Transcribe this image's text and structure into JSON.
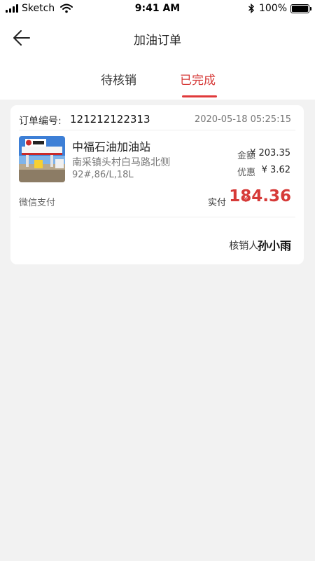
{
  "status_bar": {
    "carrier": "Sketch",
    "time": "9:41 AM",
    "battery_text": "100%",
    "battery_level": 1.0,
    "icons": [
      "signal-icon",
      "wifi-icon",
      "bluetooth-icon",
      "battery-icon"
    ]
  },
  "nav": {
    "title": "加油订单",
    "back_icon": "arrow-left-icon"
  },
  "tabs": {
    "items": [
      {
        "label": "待核销",
        "active": false
      },
      {
        "label": "已完成",
        "active": true
      }
    ],
    "active_color": "#e0393a"
  },
  "order": {
    "number_label": "订单编号:",
    "number": "121212122313",
    "time": "2020-05-18 05:25:15",
    "station": {
      "name": "中福石油加油站",
      "address": "南采镇头村白马路北侧",
      "spec": "92#,86/L,18L"
    },
    "amount_label": "金额",
    "amount": "¥ 203.35",
    "discount_label": "优惠",
    "discount": "¥ 3.62",
    "payment_method": "微信支付",
    "paid_label": "实付",
    "paid_currency": "¥",
    "paid": "184.36",
    "verifier_label": "核销人:",
    "verifier": "孙小雨"
  },
  "colors": {
    "accent": "#d63a38",
    "background": "#f2f2f2"
  }
}
